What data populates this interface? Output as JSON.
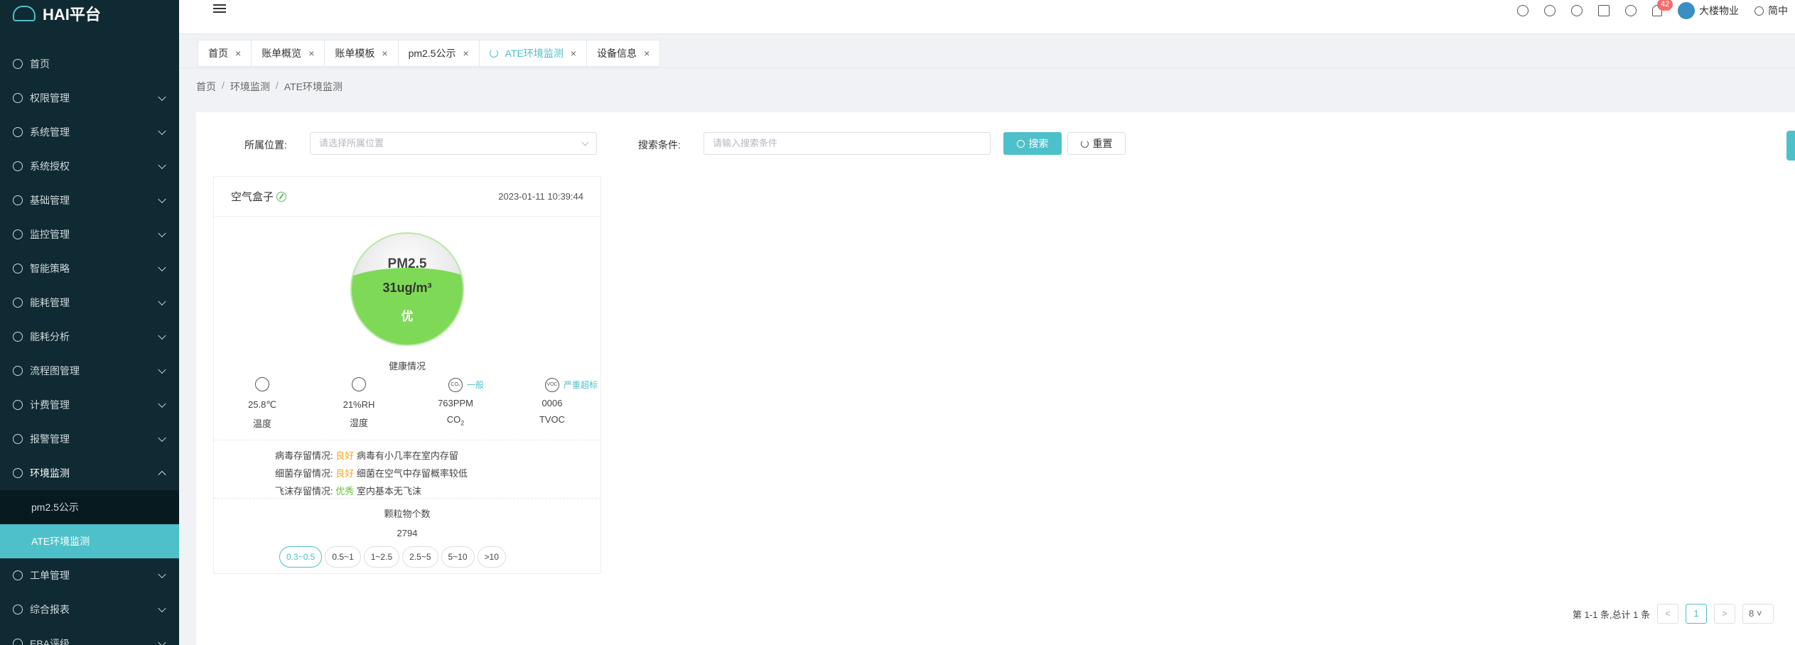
{
  "app": {
    "title": "HAI平台",
    "logo_icon": "cloud-icon"
  },
  "sidebar": {
    "items": [
      {
        "label": "首页",
        "icon": "home-icon"
      },
      {
        "label": "权限管理",
        "icon": "shield-icon"
      },
      {
        "label": "系统管理",
        "icon": "monitor-icon"
      },
      {
        "label": "系统授权",
        "icon": "key-icon"
      },
      {
        "label": "基础管理",
        "icon": "grid-icon"
      },
      {
        "label": "监控管理",
        "icon": "camera-icon"
      },
      {
        "label": "智能策略",
        "icon": "bulb-icon"
      },
      {
        "label": "能耗管理",
        "icon": "sliders-icon"
      },
      {
        "label": "能耗分析",
        "icon": "chart-icon"
      },
      {
        "label": "流程图管理",
        "icon": "flow-icon"
      },
      {
        "label": "计费管理",
        "icon": "wallet-icon"
      },
      {
        "label": "报警管理",
        "icon": "alarm-icon"
      },
      {
        "label": "环境监测",
        "icon": "leaf-icon",
        "children": [
          {
            "label": "pm2.5公示"
          },
          {
            "label": "ATE环境监测"
          }
        ]
      },
      {
        "label": "工单管理",
        "icon": "layers-icon"
      },
      {
        "label": "综合报表",
        "icon": "report-icon"
      },
      {
        "label": "EBA评级",
        "icon": "badge-icon"
      }
    ]
  },
  "topbar": {
    "notification_count": "42",
    "user": "大楼物业",
    "lang": "简中"
  },
  "tabs": [
    {
      "label": "首页"
    },
    {
      "label": "账单概览"
    },
    {
      "label": "账单模板"
    },
    {
      "label": "pm2.5公示"
    },
    {
      "label": "ATE环境监测"
    },
    {
      "label": "设备信息"
    }
  ],
  "breadcrumb": [
    "首页",
    "环境监测",
    "ATE环境监测"
  ],
  "filter": {
    "location_label": "所属位置:",
    "location_placeholder": "请选择所属位置",
    "search_label": "搜索条件:",
    "search_placeholder": "请输入搜索条件",
    "search_button": "搜索",
    "reset_button": "重置"
  },
  "card": {
    "title": "空气盒子",
    "time": "2023-01-11 10:39:44",
    "gauge": {
      "title": "PM2.5",
      "value": "31ug/m³",
      "level": "优",
      "fill": 0.55
    },
    "health_label": "健康情况",
    "metrics": [
      {
        "icon": "thermometer-icon",
        "value": "25.8℃",
        "label": "温度",
        "tag": ""
      },
      {
        "icon": "droplet-icon",
        "value": "21%RH",
        "label": "湿度",
        "tag": ""
      },
      {
        "icon": "co2-icon",
        "value": "763PPM",
        "label": "CO",
        "tag": "一般"
      },
      {
        "icon": "voc-icon",
        "value": "0006",
        "label": "TVOC",
        "tag": "严重超标"
      }
    ],
    "survival": [
      {
        "label": "病毒存留情况:",
        "status": "良好",
        "desc": "病毒有小几率在室内存留"
      },
      {
        "label": "细菌存留情况:",
        "status": "良好",
        "desc": "细菌在空气中存留概率较低"
      },
      {
        "label": "飞沫存留情况:",
        "status": "优秀",
        "desc": "室内基本无飞沫"
      }
    ],
    "particle_label": "颗粒物个数",
    "particle_count": "2794",
    "ranges": [
      "0.3~0.5",
      "0.5~1",
      "1~2.5",
      "2.5~5",
      "5~10",
      ">10"
    ]
  },
  "pager": {
    "summary": "第 1-1 条,总计 1 条",
    "current": "1",
    "size": "8"
  }
}
